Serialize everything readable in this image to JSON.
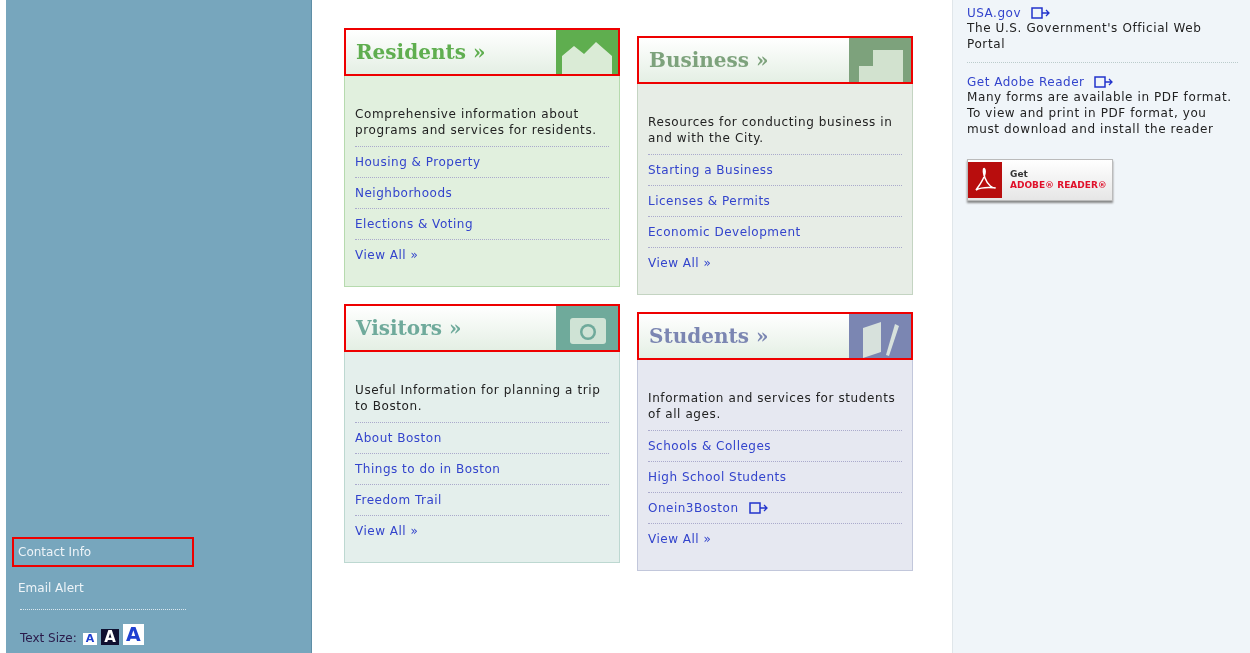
{
  "sidebar": {
    "links": [
      {
        "label": "Contact Info",
        "highlighted": true
      },
      {
        "label": "Email Alert",
        "highlighted": false
      }
    ],
    "text_size": {
      "label": "Text Size:",
      "options": [
        {
          "label": "A",
          "selected": false
        },
        {
          "label": "A",
          "selected": true
        },
        {
          "label": "A",
          "selected": false
        }
      ]
    }
  },
  "columns": [
    [
      {
        "title": "Residents »",
        "kind": "house",
        "color": "#5fae4f",
        "highlighted": true,
        "description": "Comprehensive information about programs and services for residents.",
        "links": [
          {
            "label": "Housing & Property",
            "external": false
          },
          {
            "label": "Neighborhoods",
            "external": false
          },
          {
            "label": "Elections & Voting",
            "external": false
          }
        ],
        "view_all": "View All »"
      },
      {
        "title": "Visitors »",
        "kind": "camera",
        "color": "#6faa9b",
        "highlighted": true,
        "description": "Useful Information for planning a trip to Boston.",
        "links": [
          {
            "label": "About Boston",
            "external": false
          },
          {
            "label": "Things to do in Boston",
            "external": false
          },
          {
            "label": "Freedom Trail",
            "external": false
          }
        ],
        "view_all": "View All »"
      }
    ],
    [
      {
        "title": "Business »",
        "kind": "building",
        "color": "#7da27c",
        "highlighted": true,
        "description": "Resources for conducting business in and with the City.",
        "links": [
          {
            "label": "Starting a Business",
            "external": false
          },
          {
            "label": "Licenses & Permits",
            "external": false
          },
          {
            "label": "Economic Development",
            "external": false
          }
        ],
        "view_all": "View All »"
      },
      {
        "title": "Students »",
        "kind": "book",
        "color": "#7b86b2",
        "highlighted": true,
        "description": "Information and services for students of all ages.",
        "links": [
          {
            "label": "Schools & Colleges",
            "external": false
          },
          {
            "label": "High School Students",
            "external": false
          },
          {
            "label": "Onein3Boston",
            "external": true
          }
        ],
        "view_all": "View All »"
      }
    ]
  ],
  "resources": [
    {
      "link": "USA.gov",
      "external": true,
      "description": "The U.S. Government's Official Web Portal"
    },
    {
      "link": "Get Adobe Reader",
      "external": true,
      "description": "Many forms are available in PDF format. To view and print in PDF format, you must download and install the reader"
    }
  ],
  "adobe_badge": {
    "line1": "Get",
    "brand": "ADOBE® READER®"
  }
}
